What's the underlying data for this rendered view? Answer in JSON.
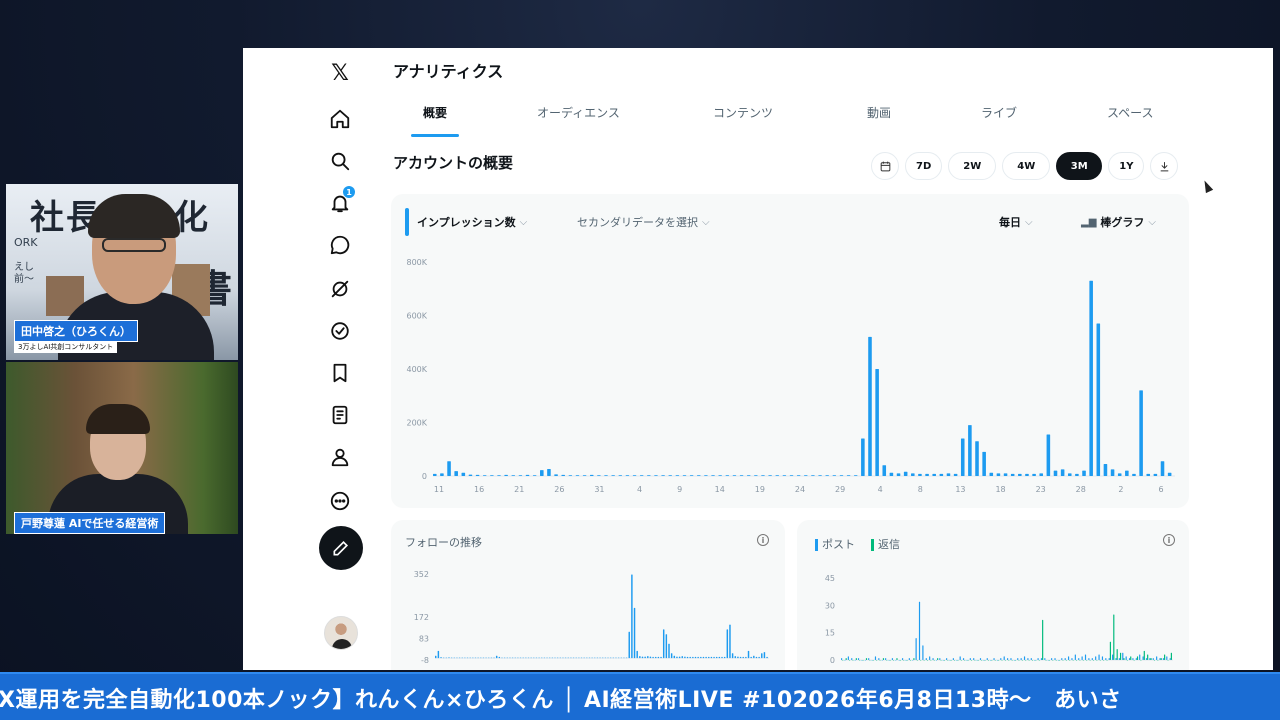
{
  "webcam": {
    "top": {
      "background_text": "社長無人化",
      "background_glyph": "書",
      "background_sub": "ORK",
      "background_sub2": "えし\n前〜",
      "name_label": "田中啓之（ひろくん）",
      "sub_label": "3万よしAI共創コンサルタント"
    },
    "bottom": {
      "name_label": "戸野尊蓮 AIで任せる経営術"
    }
  },
  "sidebar": {
    "logo": "𝕏",
    "icons": [
      "home-icon",
      "search-icon",
      "bell-icon",
      "message-icon",
      "grok-icon",
      "verified-icon",
      "bookmark-icon",
      "article-icon",
      "profile-icon",
      "more-icon"
    ],
    "notification_badge": "1"
  },
  "header": {
    "title": "アナリティクス"
  },
  "tabs": [
    {
      "label": "概要",
      "active": true
    },
    {
      "label": "オーディエンス",
      "active": false
    },
    {
      "label": "コンテンツ",
      "active": false
    },
    {
      "label": "動画",
      "active": false
    },
    {
      "label": "ライブ",
      "active": false
    },
    {
      "label": "スペース",
      "active": false
    }
  ],
  "overview": {
    "title": "アカウントの概要",
    "ranges": [
      "7D",
      "2W",
      "4W",
      "3M",
      "1Y"
    ],
    "active_range": "3M"
  },
  "main_chart": {
    "metric_select": "インプレッション数",
    "secondary_select": "セカンダリデータを選択",
    "interval_select": "毎日",
    "chart_type_select": "棒グラフ",
    "chart_type_icon": "bar-chart-icon"
  },
  "follow_chart": {
    "title": "フォローの推移"
  },
  "posts_chart": {
    "legend": [
      {
        "name": "ポスト",
        "color": "#1d9bf0"
      },
      {
        "name": "返信",
        "color": "#00ba7c"
      }
    ]
  },
  "ticker": {
    "text": "X運用を完全自動化100本ノック】れんくん×ひろくん │ AI経営術LIVE #102026年6月8日13時〜　あいさ"
  },
  "chart_data": [
    {
      "type": "bar",
      "title": "",
      "ylabel": "",
      "xlabel": "",
      "ylim": [
        0,
        800000
      ],
      "yticks": [
        "0",
        "200K",
        "400K",
        "600K",
        "800K"
      ],
      "xticks": [
        "11",
        "16",
        "21",
        "26",
        "31",
        "4",
        "9",
        "14",
        "19",
        "24",
        "29",
        "4",
        "8",
        "13",
        "18",
        "23",
        "28",
        "2",
        "6"
      ],
      "series": [
        {
          "name": "インプレッション数",
          "color": "#1d9bf0",
          "values": [
            8000,
            10000,
            55000,
            18000,
            12000,
            5000,
            4000,
            3000,
            3000,
            3000,
            4000,
            3000,
            3000,
            4000,
            3000,
            22000,
            26000,
            6000,
            4000,
            3000,
            3000,
            3000,
            4000,
            3000,
            3000,
            3000,
            3000,
            3000,
            3000,
            3000,
            3000,
            3000,
            3000,
            3000,
            3000,
            3000,
            3000,
            3000,
            3000,
            3000,
            3000,
            3000,
            3000,
            3000,
            3000,
            3000,
            3000,
            3000,
            3000,
            3000,
            3000,
            3000,
            3000,
            3000,
            3000,
            3000,
            3000,
            3000,
            3000,
            3000,
            140000,
            520000,
            400000,
            40000,
            12000,
            10000,
            16000,
            10000,
            8000,
            8000,
            8000,
            8000,
            10000,
            8000,
            140000,
            190000,
            130000,
            90000,
            12000,
            10000,
            10000,
            8000,
            8000,
            8000,
            8000,
            10000,
            155000,
            20000,
            25000,
            10000,
            8000,
            20000,
            730000,
            570000,
            45000,
            25000,
            10000,
            20000,
            8000,
            320000,
            8000,
            8000,
            55000,
            12000
          ]
        }
      ]
    },
    {
      "type": "bar",
      "title": "フォローの推移",
      "ylim": [
        -8,
        352
      ],
      "yticks": [
        "-8",
        "83",
        "172",
        "352"
      ],
      "series": [
        {
          "name": "",
          "color": "#1d9bf0",
          "values": [
            10,
            30,
            4,
            2,
            2,
            3,
            2,
            2,
            2,
            2,
            2,
            2,
            2,
            2,
            2,
            2,
            2,
            2,
            2,
            2,
            2,
            2,
            2,
            10,
            5,
            2,
            2,
            2,
            2,
            2,
            2,
            2,
            2,
            2,
            2,
            2,
            2,
            2,
            2,
            2,
            2,
            2,
            2,
            2,
            2,
            2,
            2,
            2,
            2,
            2,
            2,
            2,
            2,
            2,
            2,
            2,
            2,
            2,
            2,
            2,
            2,
            2,
            2,
            2,
            2,
            2,
            2,
            2,
            2,
            2,
            2,
            2,
            2,
            110,
            350,
            210,
            30,
            8,
            6,
            6,
            8,
            6,
            5,
            5,
            5,
            5,
            120,
            100,
            60,
            20,
            10,
            6,
            6,
            8,
            6,
            5,
            5,
            5,
            5,
            5,
            5,
            5,
            5,
            5,
            5,
            5,
            5,
            5,
            5,
            5,
            120,
            140,
            20,
            8,
            6,
            5,
            5,
            5,
            30,
            5,
            10,
            5,
            5,
            20,
            25,
            5
          ]
        }
      ]
    },
    {
      "type": "bar",
      "title": "",
      "ylim": [
        0,
        45
      ],
      "yticks": [
        "0",
        "15",
        "30",
        "45"
      ],
      "series": [
        {
          "name": "ポスト",
          "color": "#1d9bf0",
          "values": [
            1,
            0,
            2,
            1,
            0,
            1,
            0,
            0,
            1,
            0,
            2,
            1,
            0,
            1,
            0,
            1,
            0,
            0,
            1,
            0,
            1,
            0,
            12,
            32,
            8,
            1,
            2,
            1,
            0,
            1,
            0,
            1,
            0,
            1,
            0,
            2,
            1,
            0,
            1,
            1,
            0,
            1,
            0,
            1,
            0,
            1,
            0,
            1,
            2,
            1,
            1,
            0,
            1,
            1,
            2,
            1,
            1,
            0,
            1,
            1,
            1,
            0,
            1,
            1,
            0,
            1,
            1,
            2,
            1,
            3,
            1,
            2,
            3,
            1,
            1,
            2,
            3,
            2,
            1,
            1,
            3,
            1,
            1,
            4,
            2,
            1,
            1,
            1,
            3,
            2,
            1,
            1,
            1,
            2,
            1,
            1,
            2,
            1
          ]
        },
        {
          "name": "返信",
          "color": "#00ba7c",
          "values": [
            0,
            1,
            0,
            0,
            1,
            0,
            0,
            1,
            0,
            0,
            0,
            0,
            1,
            0,
            0,
            0,
            1,
            0,
            0,
            0,
            0,
            1,
            0,
            0,
            0,
            0,
            0,
            0,
            1,
            0,
            0,
            0,
            0,
            0,
            0,
            0,
            0,
            0,
            0,
            0,
            0,
            0,
            0,
            0,
            0,
            0,
            0,
            0,
            0,
            0,
            0,
            0,
            0,
            0,
            0,
            0,
            0,
            0,
            0,
            22,
            0,
            0,
            0,
            0,
            0,
            0,
            0,
            0,
            0,
            0,
            0,
            0,
            0,
            0,
            0,
            0,
            0,
            0,
            0,
            10,
            25,
            6,
            4,
            1,
            0,
            2,
            0,
            2,
            0,
            5,
            3,
            1,
            0,
            0,
            1,
            3,
            0,
            4
          ]
        }
      ]
    }
  ]
}
